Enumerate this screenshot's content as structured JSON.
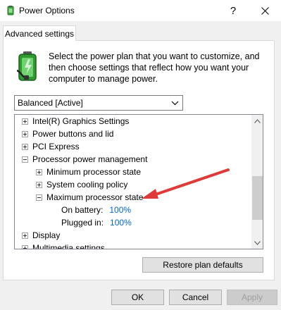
{
  "window": {
    "title": "Power Options",
    "help_glyph": "?",
    "icon": "power-options-icon"
  },
  "tabs": [
    {
      "label": "Advanced settings",
      "active": true
    }
  ],
  "intro": {
    "text": "Select the power plan that you want to customize, and then choose settings that reflect how you want your computer to manage power.",
    "icon": "battery-icon"
  },
  "plan_select": {
    "value": "Balanced [Active]"
  },
  "tree": {
    "items": [
      {
        "label": "Intel(R) Graphics Settings",
        "level": 0,
        "state": "collapsed"
      },
      {
        "label": "Power buttons and lid",
        "level": 0,
        "state": "collapsed"
      },
      {
        "label": "PCI Express",
        "level": 0,
        "state": "collapsed"
      },
      {
        "label": "Processor power management",
        "level": 0,
        "state": "expanded"
      },
      {
        "label": "Minimum processor state",
        "level": 1,
        "state": "collapsed"
      },
      {
        "label": "System cooling policy",
        "level": 1,
        "state": "collapsed"
      },
      {
        "label": "Maximum processor state",
        "level": 1,
        "state": "expanded"
      },
      {
        "label": "On battery:",
        "value": "100%",
        "level": 2
      },
      {
        "label": "Plugged in:",
        "value": "100%",
        "level": 2
      },
      {
        "label": "Display",
        "level": 0,
        "state": "collapsed"
      },
      {
        "label": "Multimedia settings",
        "level": 0,
        "state": "collapsed"
      }
    ]
  },
  "annotation": {
    "color": "#e0393a",
    "points_to": "Maximum processor state"
  },
  "buttons": {
    "restore": "Restore plan defaults",
    "ok": "OK",
    "cancel": "Cancel",
    "apply": "Apply"
  },
  "colors": {
    "link": "#0066cc",
    "dialog_bg": "#f0f0f0",
    "arrow": "#e0393a"
  }
}
